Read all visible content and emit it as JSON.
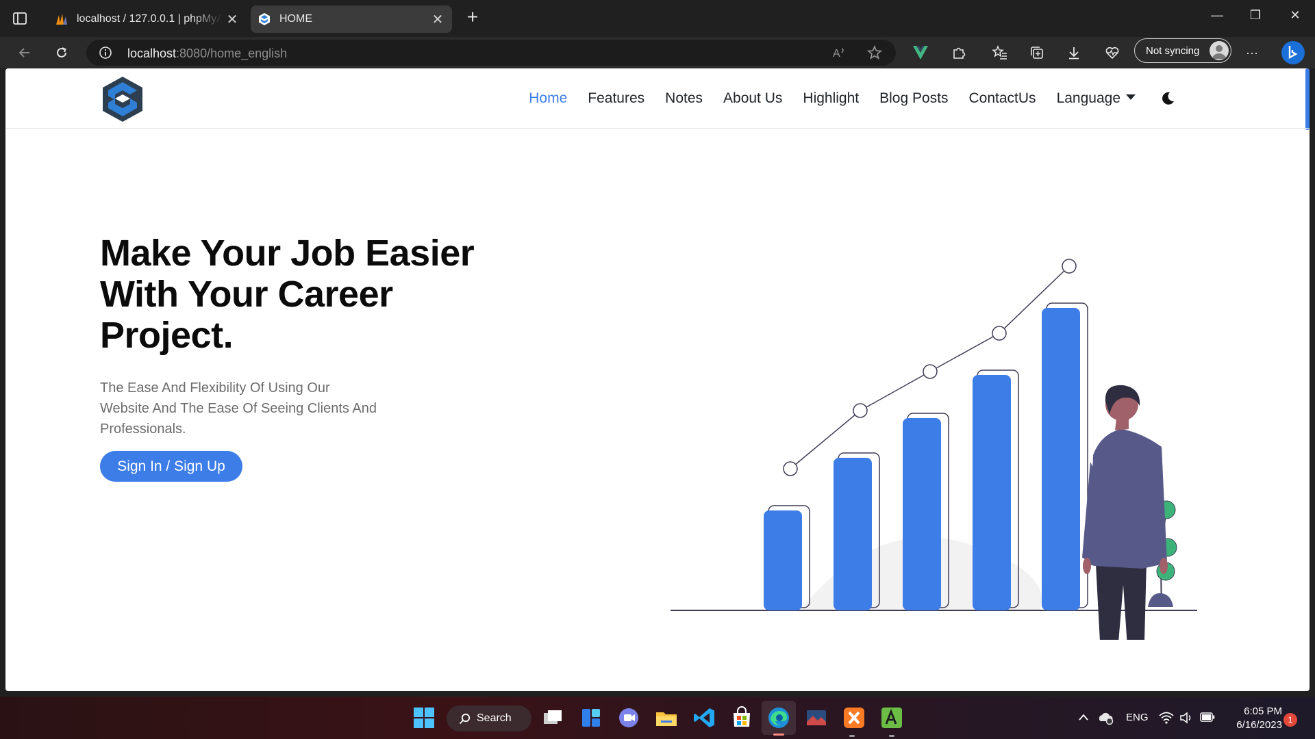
{
  "browser": {
    "tabs": [
      {
        "title": "localhost / 127.0.0.1 | phpMyAdmin",
        "active": false,
        "close": "✕"
      },
      {
        "title": "HOME",
        "active": true,
        "close": "✕"
      }
    ],
    "new_tab": "+",
    "url_host": "localhost",
    "url_rest": ":8080/home_english",
    "sync_label": "Not syncing",
    "window_controls": {
      "minimize": "—",
      "maximize": "❐",
      "close": "✕"
    },
    "more": "···"
  },
  "site": {
    "nav": {
      "links": [
        "Home",
        "Features",
        "Notes",
        "About Us",
        "Highlight",
        "Blog Posts",
        "ContactUs"
      ],
      "language": "Language",
      "active_index": 0
    },
    "hero": {
      "title_line1": "Make Your Job Easier",
      "title_line2": "With Your Career",
      "title_line3": "Project.",
      "subtitle_line1": "The Ease And Flexibility Of Using Our",
      "subtitle_line2": "Website And The Ease Of Seeing Clients And",
      "subtitle_line3": "Professionals.",
      "cta": "Sign In / Sign Up"
    },
    "colors": {
      "accent": "#3d7de8",
      "suit": "#575a89",
      "plant": "#3db37a"
    }
  },
  "taskbar": {
    "search_label": "Search",
    "language": "ENG",
    "time": "6:05 PM",
    "date": "6/16/2023",
    "notifications": "1"
  }
}
